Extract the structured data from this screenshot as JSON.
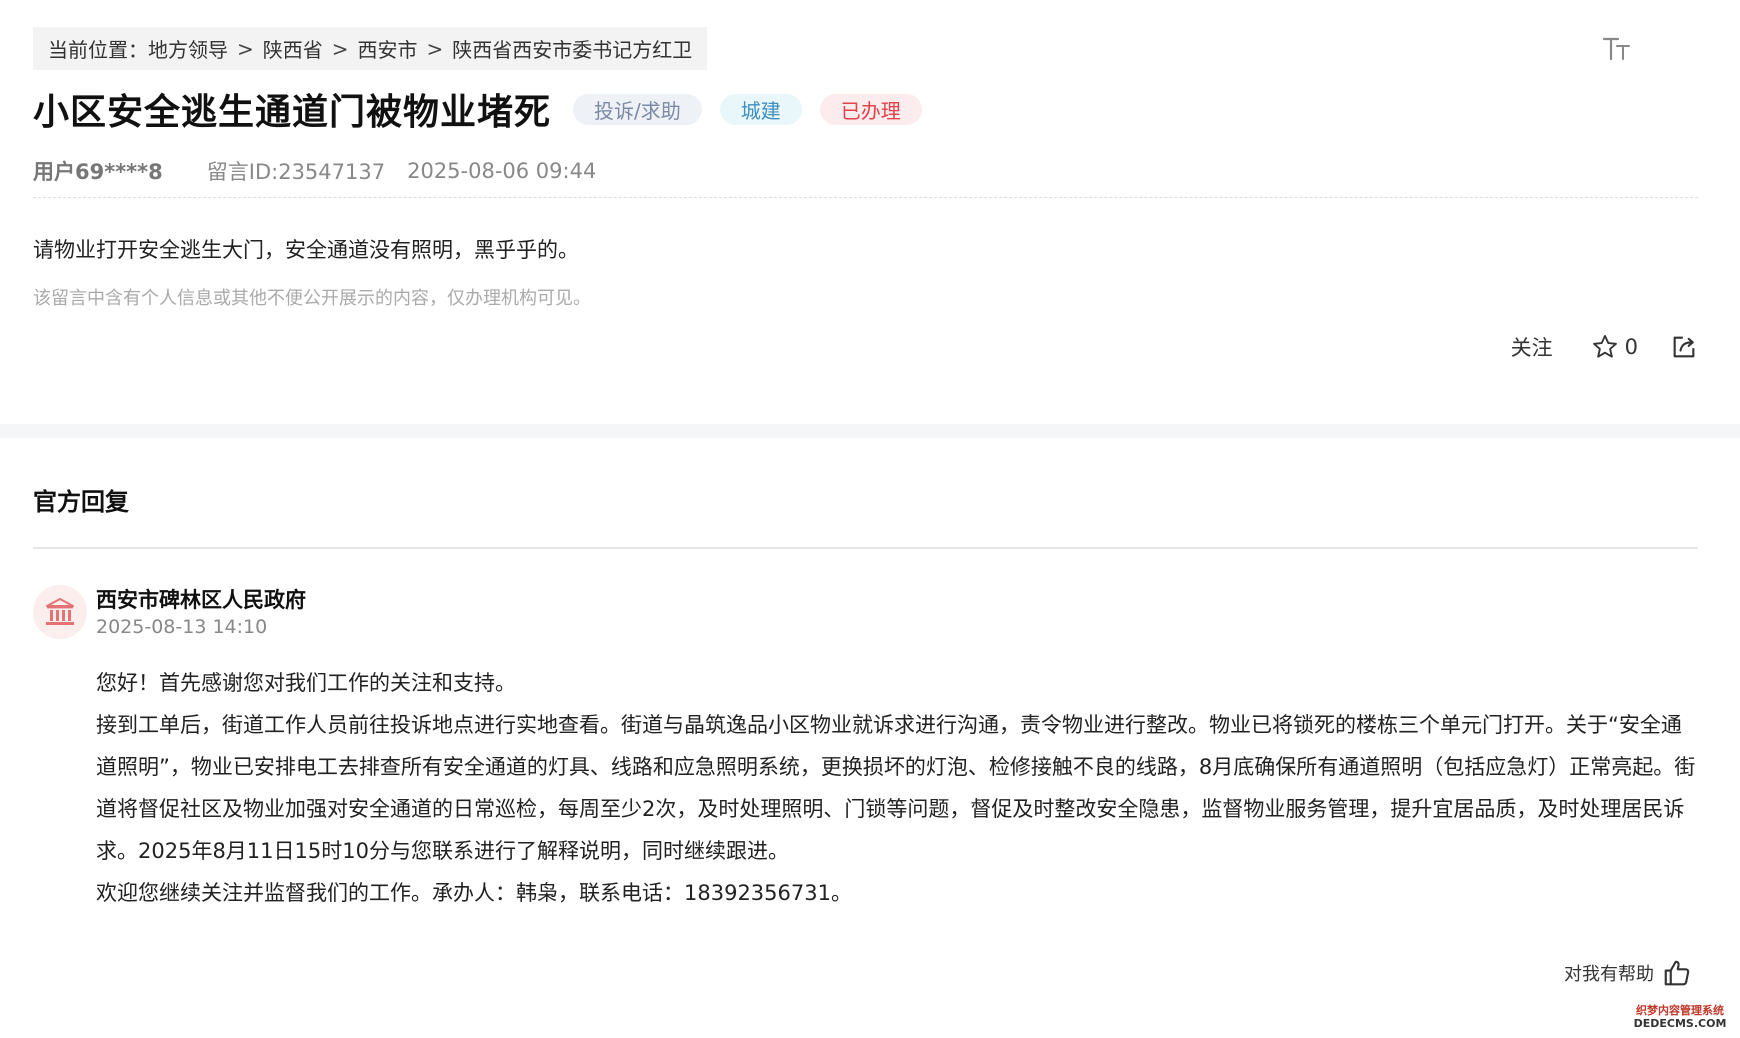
{
  "breadcrumb": {
    "prefix": "当前位置：",
    "items": [
      "地方领导",
      "陕西省",
      "西安市",
      "陕西省西安市委书记方红卫"
    ],
    "separator": ">"
  },
  "message": {
    "title": "小区安全逃生通道门被物业堵死",
    "tags": {
      "type": "投诉/求助",
      "category": "城建",
      "status": "已办理"
    },
    "user": "用户69****8",
    "message_id": "留言ID:23547137",
    "time": "2025-08-06 09:44",
    "content": "请物业打开安全逃生大门，安全通道没有照明，黑乎乎的。",
    "privacy_note": "该留言中含有个人信息或其他不便公开展示的内容，仅办理机构可见。"
  },
  "actions": {
    "follow_label": "关注",
    "like_count": "0"
  },
  "reply": {
    "heading": "官方回复",
    "org_name": "西安市碑林区人民政府",
    "time": "2025-08-13 14:10",
    "paragraphs": [
      "您好！首先感谢您对我们工作的关注和支持。",
      "接到工单后，街道工作人员前往投诉地点进行实地查看。街道与晶筑逸品小区物业就诉求进行沟通，责令物业进行整改。物业已将锁死的楼栋三个单元门打开。关于“安全通道照明”，物业已安排电工去排查所有安全通道的灯具、线路和应急照明系统，更换损坏的灯泡、检修接触不良的线路，8月底确保所有通道照明（包括应急灯）正常亮起。街道将督促社区及物业加强对安全通道的日常巡检，每周至少2次，及时处理照明、门锁等问题，督促及时整改安全隐患，监督物业服务管理，提升宜居品质，及时处理居民诉求。2025年8月11日15时10分与您联系进行了解释说明，同时继续跟进。",
      "欢迎您继续关注并监督我们的工作。承办人：韩枭，联系电话：18392356731。"
    ],
    "helpful_label": "对我有帮助"
  },
  "watermark": {
    "line1": "织梦内容管理系统",
    "line2": "DEDECMS.COM"
  },
  "icons": {
    "font_size": "font-size-icon",
    "star": "star-icon",
    "share": "share-icon",
    "government": "government-building-icon",
    "thumbs_up": "thumbs-up-icon"
  },
  "colors": {
    "tag_type_text": "#7c8aa6",
    "tag_category_text": "#3f8fbf",
    "tag_status_text": "#e0434c",
    "avatar_icon": "#e57373"
  }
}
